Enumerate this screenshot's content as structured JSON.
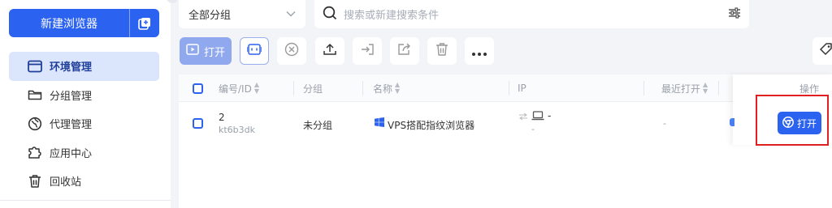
{
  "sidebar": {
    "new_browser_label": "新建浏览器",
    "items": [
      {
        "label": "环境管理",
        "icon": "window-icon",
        "active": true
      },
      {
        "label": "分组管理",
        "icon": "folder-icon",
        "active": false
      },
      {
        "label": "代理管理",
        "icon": "proxy-icon",
        "active": false
      },
      {
        "label": "应用中心",
        "icon": "puzzle-icon",
        "active": false
      },
      {
        "label": "回收站",
        "icon": "trash-icon",
        "active": false
      }
    ]
  },
  "filter": {
    "group_select_value": "全部分组",
    "search_placeholder": "搜索或新建搜索条件"
  },
  "toolbar": {
    "open_label": "打开",
    "icons": [
      "sync-window-icon",
      "close-circle-icon",
      "upload-icon",
      "move-in-icon",
      "share-icon",
      "trash-icon",
      "more-icon"
    ]
  },
  "table": {
    "headers": {
      "id": "编号/ID",
      "group": "分组",
      "name": "名称",
      "ip": "IP",
      "last_open": "最近打开",
      "action": "操作"
    },
    "rows": [
      {
        "number": "2",
        "id": "kt6b3dk",
        "group": "未分组",
        "name": "VPS搭配指纹浏览器",
        "ip_line1": "-",
        "ip_line2": "-",
        "last_open": "-",
        "action_label": "打开"
      }
    ]
  },
  "colors": {
    "accent": "#2b62f0",
    "active_nav_bg": "#dbe5fb",
    "highlight_box": "#e02020"
  }
}
